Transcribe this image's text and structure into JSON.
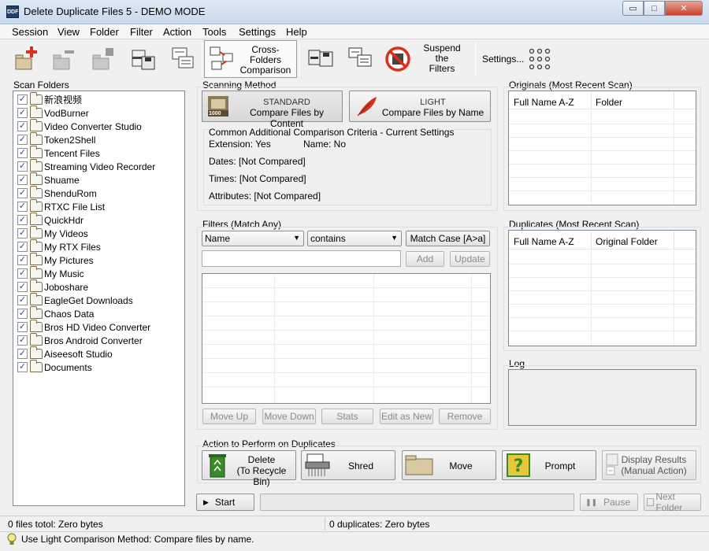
{
  "window": {
    "title": "Delete Duplicate Files 5 - DEMO MODE",
    "app_icon_text": "DDF",
    "min_glyph": "▭",
    "max_glyph": "□",
    "close_glyph": "✕"
  },
  "menu": [
    "Session",
    "View",
    "Folder",
    "Filter",
    "Action",
    "Tools",
    "Settings",
    "Help"
  ],
  "toolbar": {
    "cross_folders": "Cross-\nFolders\nComparison",
    "suspend_filters": "Suspend\nthe\nFilters",
    "settings": "Settings..."
  },
  "scan_folders": {
    "label": "Scan Folders",
    "items": [
      "新浪视频",
      "VodBurner",
      "Video Converter Studio",
      "Token2Shell",
      "Tencent Files",
      "Streaming Video Recorder",
      "Shuame",
      "ShenduRom",
      "RTXC File List",
      "QuickHdr",
      "My Videos",
      "My RTX Files",
      "My Pictures",
      "My Music",
      "Joboshare",
      "EagleGet Downloads",
      "Chaos Data",
      "Bros HD Video Converter",
      "Bros Android Converter",
      "Aiseesoft Studio",
      "Documents"
    ],
    "check_glyph": "✓"
  },
  "scanning_method": {
    "label": "Scanning Method",
    "standard_title": "STANDARD",
    "standard_sub": "Compare Files by Content",
    "standard_badge": "1000",
    "light_title": "LIGHT",
    "light_sub": "Compare Files by Name",
    "criteria_label": "Common Additional Comparison Criteria - Current Settings",
    "extension": "Extension: Yes",
    "name": "Name: No",
    "dates": "Dates:  [Not Compared]",
    "times": "Times:  [Not Compared]",
    "attributes": "Attributes:  [Not Compared]"
  },
  "filters": {
    "label": "Filters (Match Any)",
    "field_select": "Name",
    "op_select": "contains",
    "match_case": "Match Case [A>a]",
    "input_value": "",
    "add": "Add",
    "update": "Update",
    "move_up": "Move Up",
    "move_down": "Move Down",
    "stats": "Stats",
    "edit_as_new": "Edit as New",
    "remove": "Remove"
  },
  "originals": {
    "label": "Originals (Most Recent Scan)",
    "col1": "Full Name A-Z",
    "col2": "Folder"
  },
  "duplicates": {
    "label": "Duplicates (Most Recent Scan)",
    "col1": "Full Name A-Z",
    "col2": "Original Folder"
  },
  "log": {
    "label": "Log"
  },
  "actions": {
    "label": "Action to Perform on Duplicates",
    "delete": "Delete\n(To Recycle Bin)",
    "shred": "Shred",
    "move": "Move",
    "prompt": "Prompt",
    "display_results": "Display Results\n(Manual Action)"
  },
  "run": {
    "start": "Start",
    "pause": "Pause",
    "next_folder": "Next Folder",
    "play_glyph": "▶",
    "pause_glyph": "❚❚"
  },
  "status": {
    "files_total": "0 files totol: Zero bytes",
    "duplicates": "0 duplicates: Zero bytes",
    "hint": "Use Light Comparison Method: Compare files by name."
  },
  "colors": {
    "accent_red": "#d9301c",
    "folder_tan": "#d8c9a0",
    "green": "#3a8a2a",
    "yellow": "#e8c83a"
  }
}
